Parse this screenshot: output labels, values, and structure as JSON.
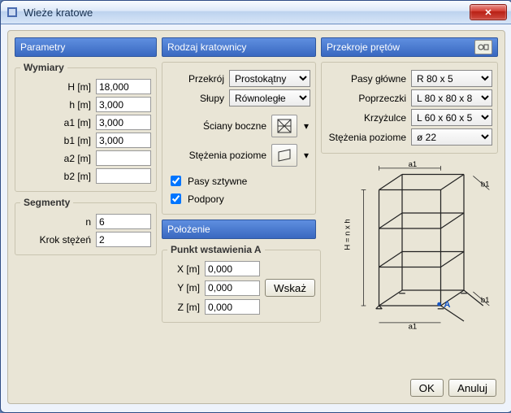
{
  "window": {
    "title": "Wieże kratowe"
  },
  "params": {
    "section_title": "Parametry",
    "dims_title": "Wymiary",
    "fields": {
      "H": {
        "label": "H [m]",
        "value": "18,000"
      },
      "h": {
        "label": "h [m]",
        "value": "3,000"
      },
      "a1": {
        "label": "a1 [m]",
        "value": "3,000"
      },
      "b1": {
        "label": "b1 [m]",
        "value": "3,000"
      },
      "a2": {
        "label": "a2 [m]",
        "value": ""
      },
      "b2": {
        "label": "b2 [m]",
        "value": ""
      }
    },
    "segments_title": "Segmenty",
    "n": {
      "label": "n",
      "value": "6"
    },
    "krok": {
      "label": "Krok stężeń",
      "value": "2"
    }
  },
  "truss": {
    "section_title": "Rodzaj kratownicy",
    "przekroj_label": "Przekrój",
    "przekroj_value": "Prostokątny",
    "slupy_label": "Słupy",
    "slupy_value": "Równoległe",
    "sciany_label": "Ściany boczne",
    "stezenia_label": "Stężenia poziome",
    "pasy_sztywne": "Pasy sztywne",
    "podpory": "Podpory"
  },
  "pos": {
    "section_title": "Położenie",
    "group_title": "Punkt wstawienia A",
    "x": {
      "label": "X [m]",
      "value": "0,000"
    },
    "y": {
      "label": "Y [m]",
      "value": "0,000"
    },
    "z": {
      "label": "Z [m]",
      "value": "0,000"
    },
    "wskaz": "Wskaż"
  },
  "sections": {
    "section_title": "Przekroje prętów",
    "pasy_glowne": {
      "label": "Pasy główne",
      "value": "R 80 x 5"
    },
    "poprzeczki": {
      "label": "Poprzeczki",
      "value": "L 80 x 80 x 8"
    },
    "krzyzulce": {
      "label": "Krzyżulce",
      "value": "L 60 x 60 x 5"
    },
    "stezenia": {
      "label": "Stężenia poziome",
      "value": "ø 22"
    }
  },
  "diagram": {
    "a1": "a1",
    "b1": "b1",
    "H": "H = n x h",
    "A": "A"
  },
  "buttons": {
    "ok": "OK",
    "cancel": "Anuluj"
  }
}
